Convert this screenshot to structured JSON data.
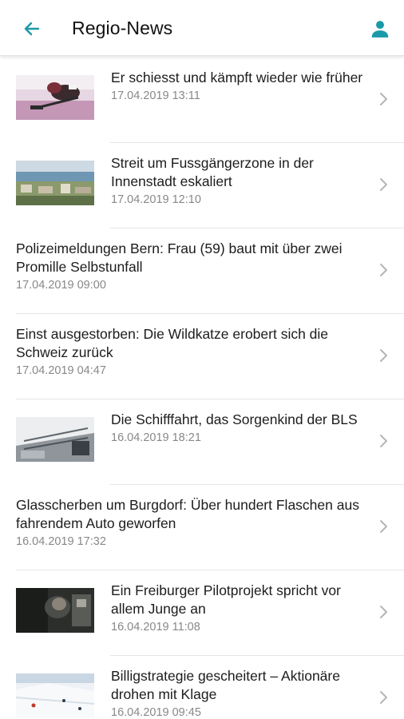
{
  "app_bar": {
    "title": "Regio-News",
    "back_icon": "arrow-left-icon",
    "profile_icon": "person-icon",
    "accent": "#1a9aa8"
  },
  "news": [
    {
      "headline": "Er schiesst und kämpft wieder wie früher",
      "timestamp": "17.04.2019 13:11",
      "has_image": true,
      "image": "ice-hockey-photo"
    },
    {
      "headline": "Streit um Fussgängerzone in der Innenstadt eskaliert",
      "timestamp": "17.04.2019 12:10",
      "has_image": true,
      "image": "town-lake-photo"
    },
    {
      "headline": "Polizeimeldungen Bern: Frau (59) baut mit über zwei Promille Selbstunfall",
      "timestamp": "17.04.2019 09:00",
      "has_image": false
    },
    {
      "headline": "Einst ausgestorben: Die Wildkatze erobert sich die Schweiz zurück",
      "timestamp": "17.04.2019 04:47",
      "has_image": false
    },
    {
      "headline": "Die Schifffahrt, das Sorgenkind der BLS",
      "timestamp": "16.04.2019 18:21",
      "has_image": true,
      "image": "ship-deck-photo"
    },
    {
      "headline": "Glasscherben um Burgdorf: Über hundert Flaschen aus fahrendem Auto geworfen",
      "timestamp": "16.04.2019 17:32",
      "has_image": false
    },
    {
      "headline": "Ein Freiburger Pilotprojekt spricht vor allem Junge an",
      "timestamp": "16.04.2019 11:08",
      "has_image": true,
      "image": "dark-interior-photo"
    },
    {
      "headline": "Billigstrategie gescheitert – Aktionäre drohen mit Klage",
      "timestamp": "16.04.2019 09:45",
      "has_image": true,
      "image": "ski-slope-photo"
    }
  ]
}
